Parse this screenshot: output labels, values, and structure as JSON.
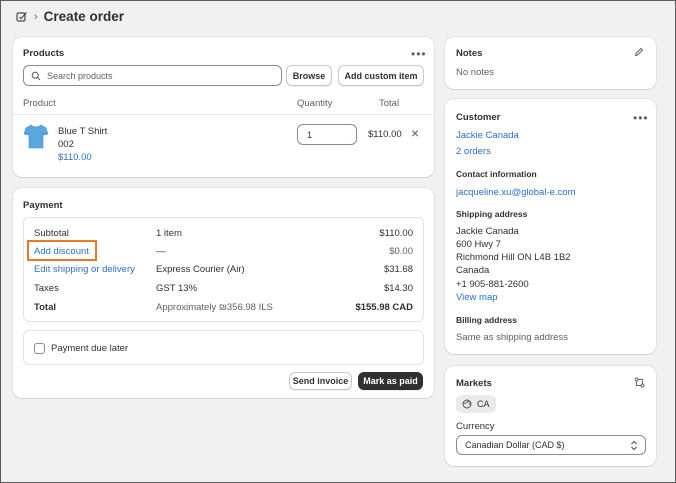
{
  "header": {
    "title": "Create order",
    "breadcrumb_sep": "›"
  },
  "products": {
    "title": "Products",
    "search_placeholder": "Search products",
    "browse_label": "Browse",
    "add_custom_label": "Add custom item",
    "columns": {
      "product": "Product",
      "quantity": "Quantity",
      "total": "Total"
    },
    "item": {
      "name": "Blue T Shirt",
      "sku": "002",
      "price": "$110.00",
      "quantity": "1",
      "total": "$110.00",
      "remove_glyph": "×"
    }
  },
  "payment": {
    "title": "Payment",
    "rows": {
      "subtotal": {
        "label": "Subtotal",
        "detail": "1 item",
        "amount": "$110.00"
      },
      "discount": {
        "label": "Add discount",
        "detail": "—",
        "amount": "$0.00"
      },
      "shipping": {
        "label": "Edit shipping or delivery",
        "detail": "Express Courier (Air)",
        "amount": "$31.68"
      },
      "taxes": {
        "label": "Taxes",
        "detail": "GST 13%",
        "amount": "$14.30"
      },
      "total": {
        "label": "Total",
        "detail": "Approximately ₪356.98 ILS",
        "amount": "$155.98 CAD"
      }
    },
    "due_later_label": "Payment due later",
    "send_invoice_label": "Send invoice",
    "mark_paid_label": "Mark as paid"
  },
  "notes": {
    "title": "Notes",
    "value": "No notes"
  },
  "customer": {
    "title": "Customer",
    "name": "Jackie Canada",
    "orders": "2 orders",
    "contact_heading": "Contact information",
    "email": "jacqueline.xu@global-e.com",
    "shipping_heading": "Shipping address",
    "address_lines": [
      "Jackie Canada",
      "600 Hwy 7",
      "Richmond Hill ON L4B 1B2",
      "Canada",
      "+1 905-881-2600"
    ],
    "view_map": "View map",
    "billing_heading": "Billing address",
    "billing_value": "Same as shipping address"
  },
  "markets": {
    "title": "Markets",
    "market_badge": "CA",
    "currency_label": "Currency",
    "currency_value": "Canadian Dollar (CAD $)"
  },
  "colors": {
    "background": "#f1f1f1",
    "link": "#2c6ecb",
    "highlight": "#e8792b",
    "dark_button": "#303030"
  }
}
